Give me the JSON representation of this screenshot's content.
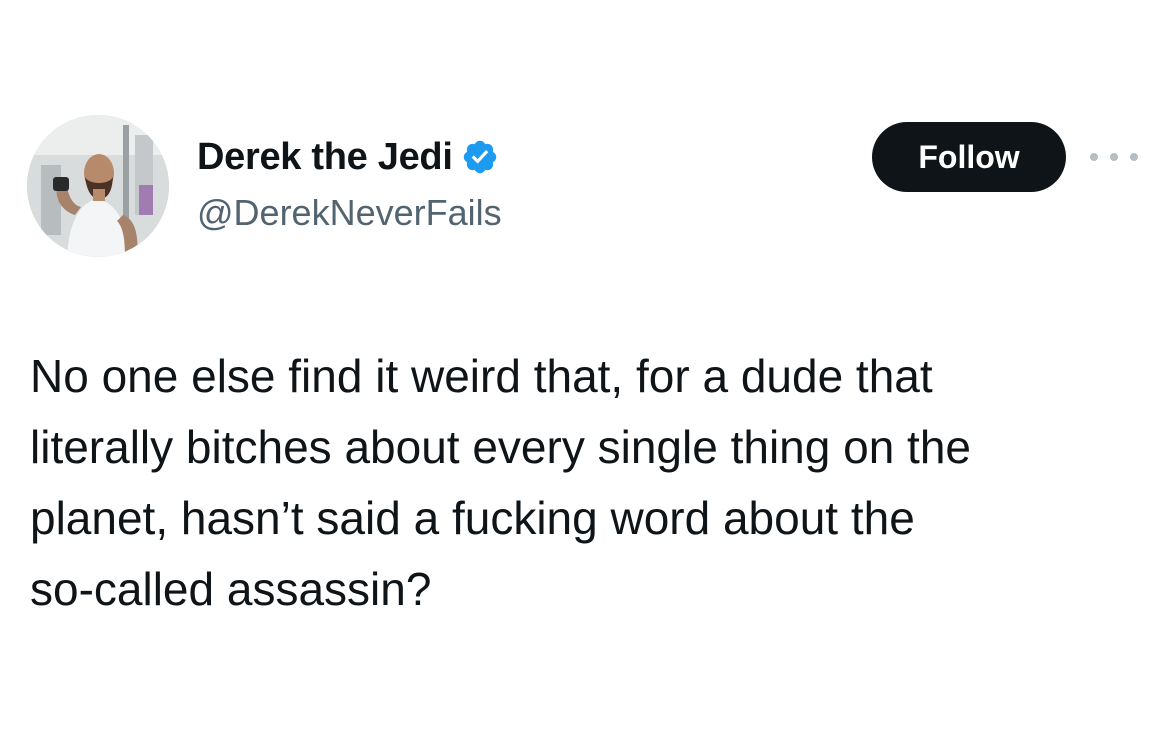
{
  "tweet": {
    "author": {
      "display_name": "Derek the Jedi",
      "handle": "@DerekNeverFails",
      "verified": true,
      "verified_icon": "verified-badge-icon",
      "verified_color": "#1d9bf0"
    },
    "follow_label": "Follow",
    "more_icon": "more-options-icon",
    "text": "No one else find it weird that, for a dude that\nliterally bitches about every single thing on the\nplanet, hasn’t said a fucking word about the\nso-called assassin?"
  },
  "colors": {
    "follow_button_bg": "#0f1419",
    "follow_button_text": "#ffffff",
    "handle_text": "#536471",
    "body_text": "#0f1419"
  }
}
